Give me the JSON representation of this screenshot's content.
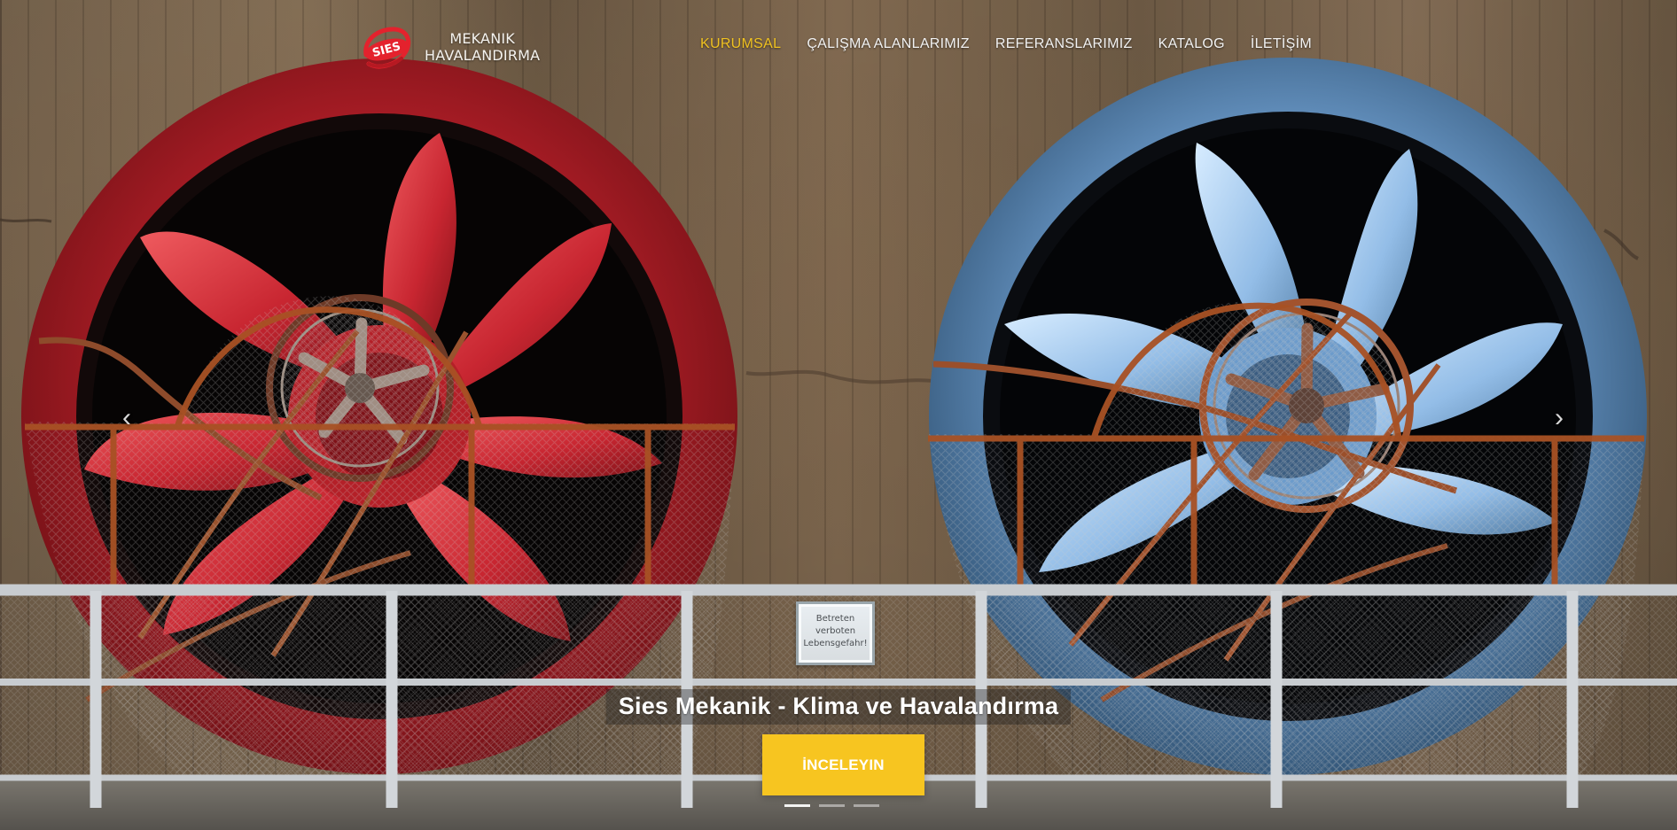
{
  "header": {
    "logo": {
      "mark_text": "SIES",
      "line1": "MEKANIK",
      "line2": "HAVALANDIRMA"
    },
    "nav": [
      {
        "label": "KURUMSAL",
        "active": true
      },
      {
        "label": "ÇALIŞMA ALANLARIMIZ",
        "active": false
      },
      {
        "label": "REFERANSLARIMIZ",
        "active": false
      },
      {
        "label": "KATALOG",
        "active": false
      },
      {
        "label": "İLETİŞİM",
        "active": false
      }
    ]
  },
  "hero": {
    "caption": "Sies Mekanik - Klima ve Havalandırma",
    "button_label": "İNCELEYIN",
    "warning_sign": [
      "Betreten",
      "verboten",
      "Lebensgefahr!"
    ],
    "controls": {
      "prev_icon": "chevron-left-icon",
      "next_icon": "chevron-right-icon"
    }
  },
  "colors": {
    "accent": "#f7c520",
    "nav_active": "#f0c221",
    "fan_red": "#b91f2a",
    "fan_blue": "#6f9fcc",
    "rust": "#b35b2c",
    "rail": "#c6cbcf"
  }
}
